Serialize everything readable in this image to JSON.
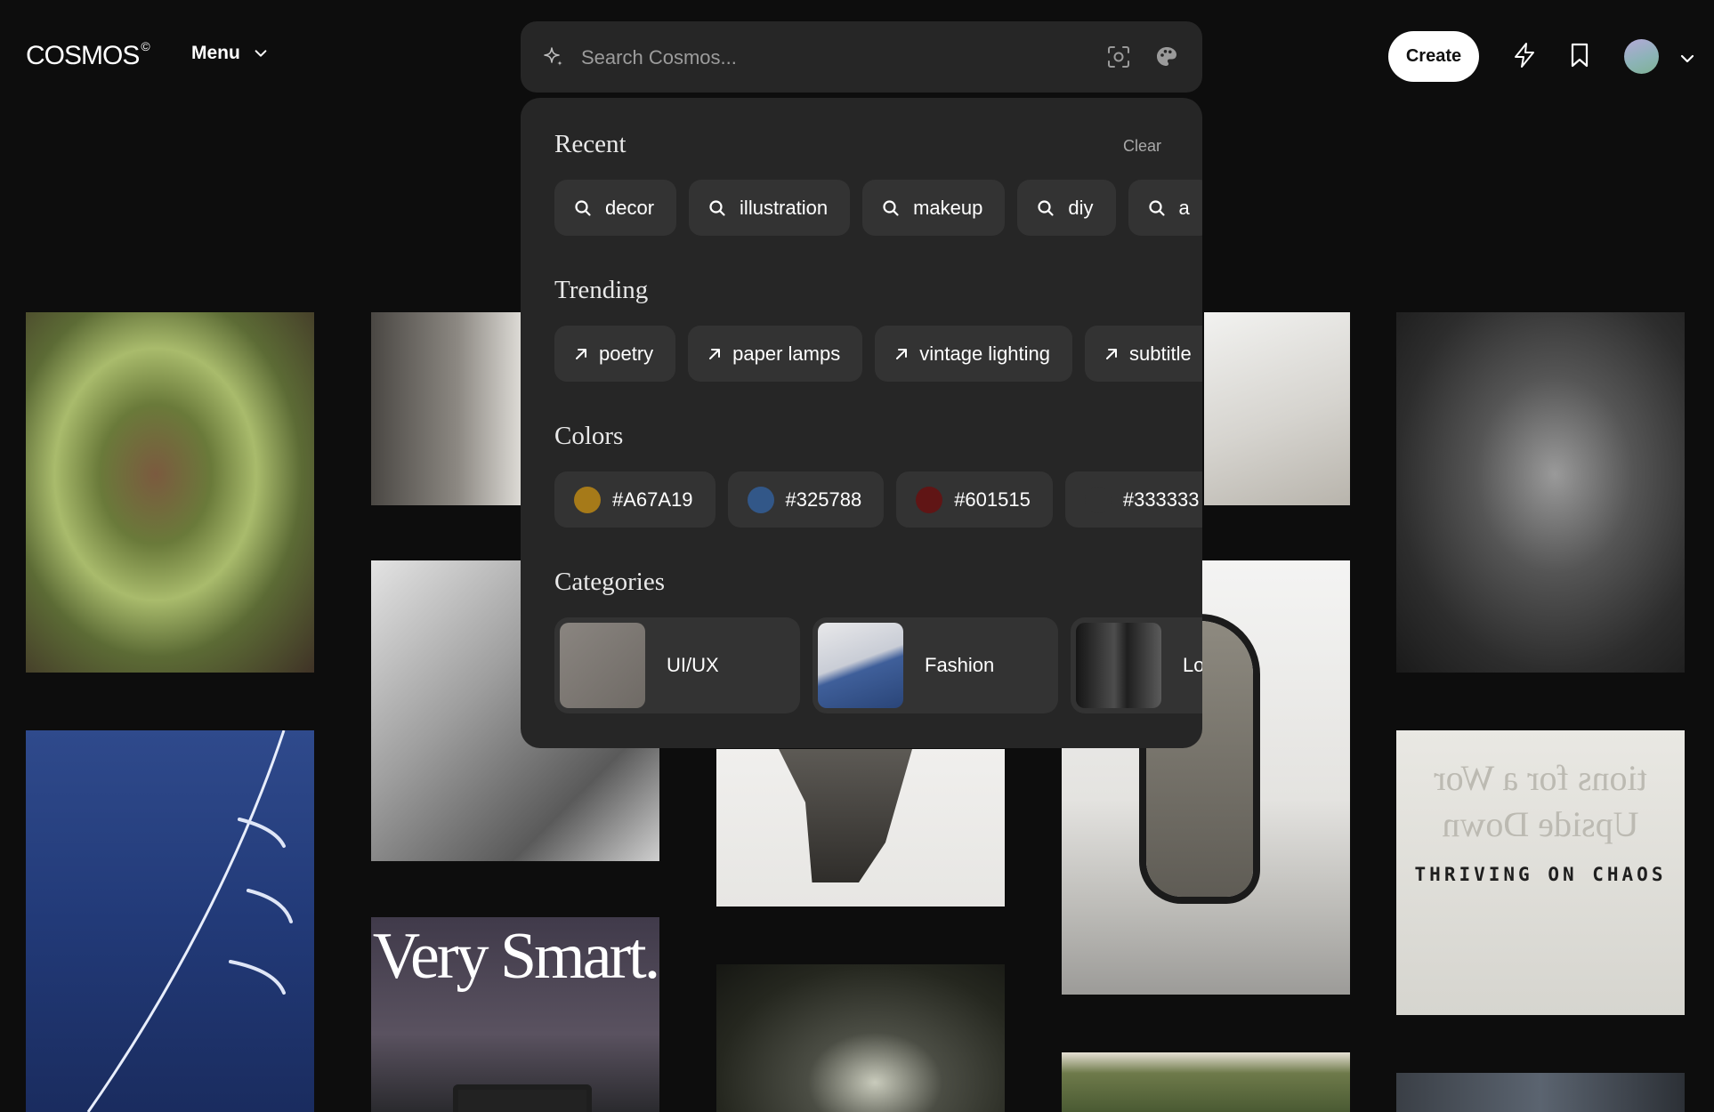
{
  "header": {
    "logo": "COSMOS",
    "logo_mark": "©",
    "menu_label": "Menu",
    "search_placeholder": "Search Cosmos...",
    "create_label": "Create",
    "icons": [
      "sparkle-icon",
      "lens-icon",
      "palette-icon",
      "lightning-icon",
      "bookmark-icon",
      "avatar",
      "chevron-down-icon"
    ]
  },
  "dropdown": {
    "recent": {
      "title": "Recent",
      "clear_label": "Clear",
      "items": [
        "decor",
        "illustration",
        "makeup",
        "diy",
        "a"
      ]
    },
    "trending": {
      "title": "Trending",
      "items": [
        "poetry",
        "paper lamps",
        "vintage lighting",
        "subtitle"
      ]
    },
    "colors": {
      "title": "Colors",
      "items": [
        {
          "label": "#A67A19",
          "hex": "#A67A19"
        },
        {
          "label": "#325788",
          "hex": "#325788"
        },
        {
          "label": "#601515",
          "hex": "#601515"
        },
        {
          "label": "#333333",
          "hex": "#333333"
        }
      ]
    },
    "categories": {
      "title": "Categories",
      "items": [
        "UI/UX",
        "Fashion",
        "Lo"
      ]
    }
  },
  "grid": {
    "poster_text": "Very Smart.",
    "thriving_text": "THRIVING ON CHAOS",
    "ghost_line_1": "tions for a Wor",
    "ghost_line_2": "Upside Down"
  }
}
